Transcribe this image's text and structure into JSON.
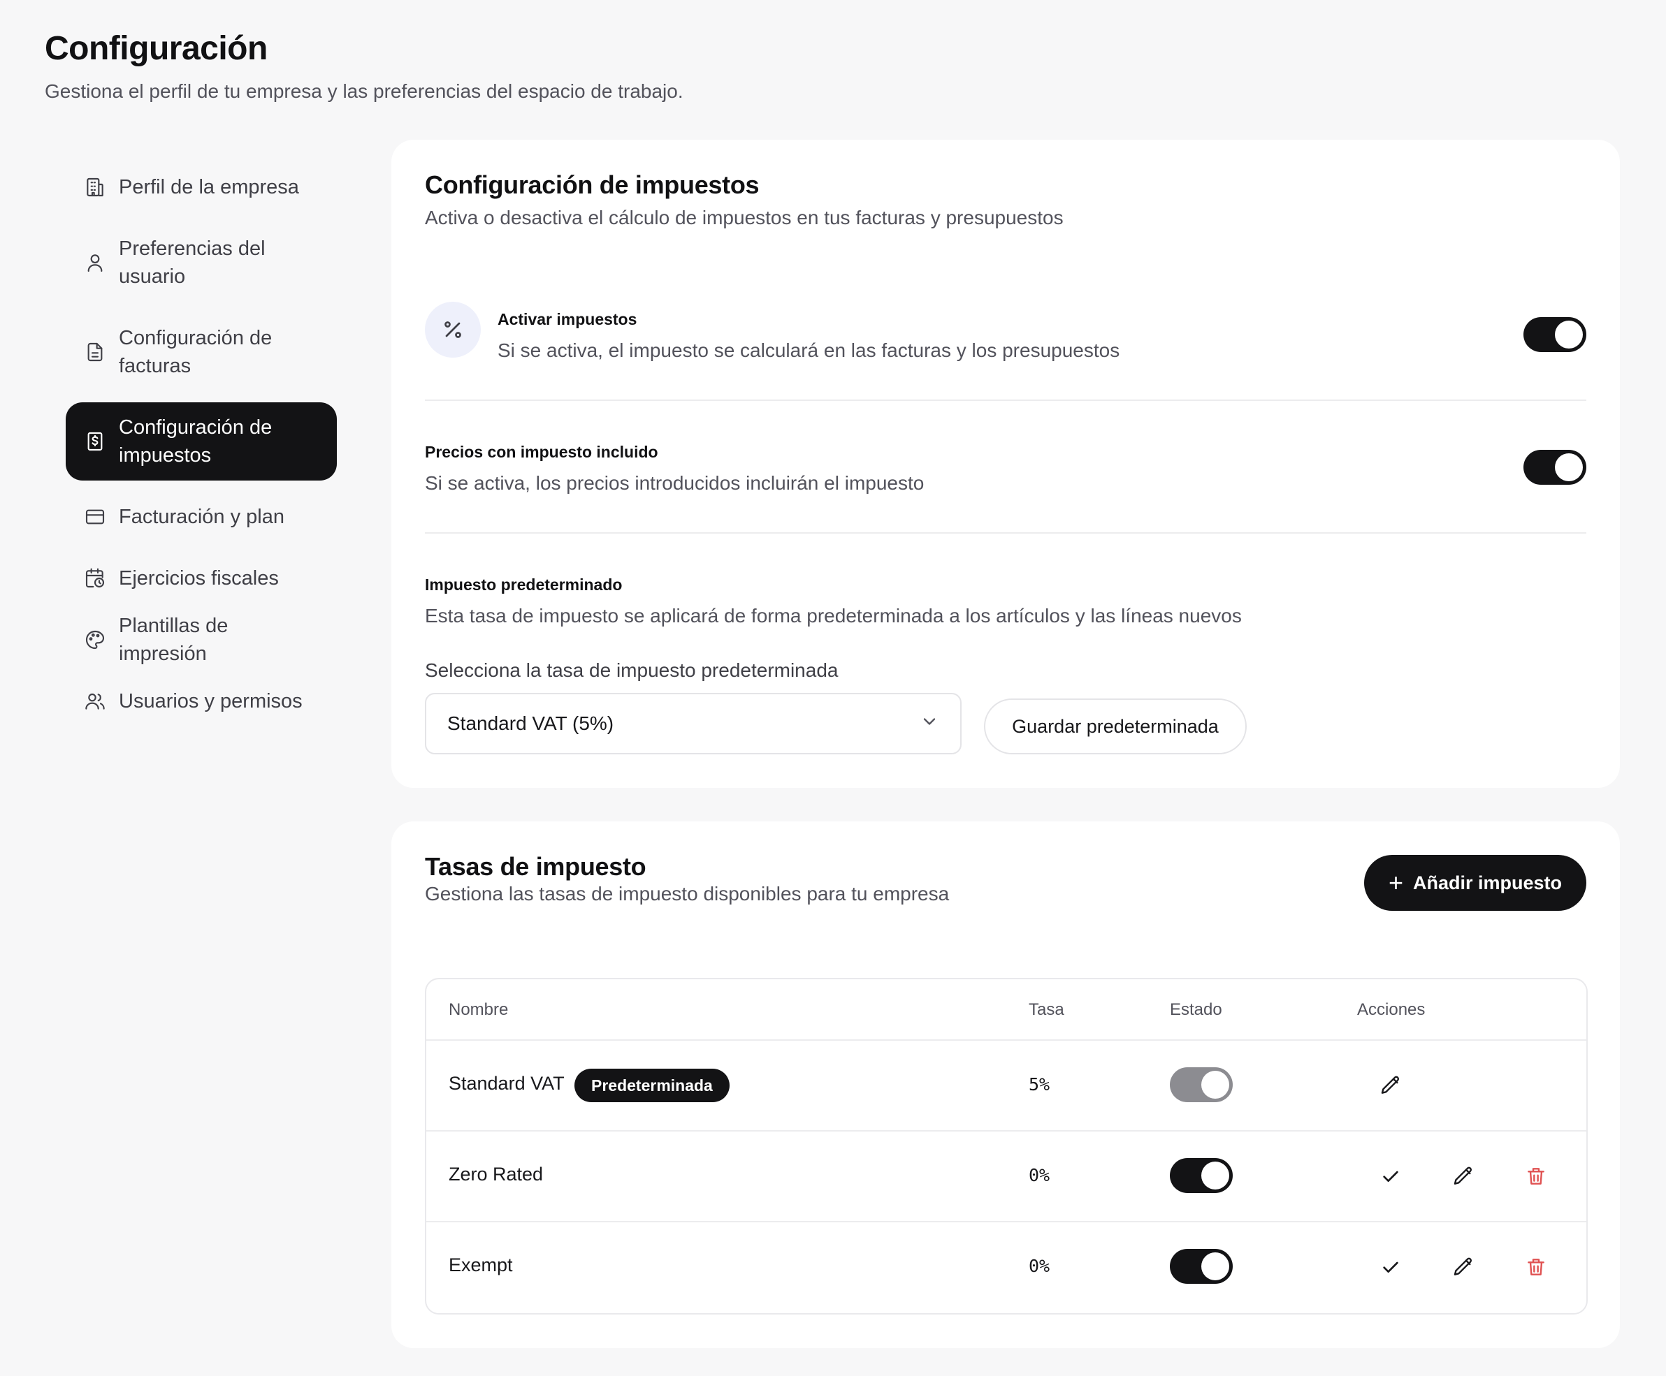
{
  "page": {
    "title": "Configuración",
    "subtitle": "Gestiona el perfil de tu empresa y las preferencias del espacio de trabajo."
  },
  "sidebar": {
    "items": [
      {
        "label": "Perfil de la empresa",
        "icon": "building-icon",
        "active": false
      },
      {
        "label": "Preferencias del usuario",
        "icon": "user-icon",
        "active": false
      },
      {
        "label": "Configuración de facturas",
        "icon": "document-icon",
        "active": false
      },
      {
        "label": "Configuración de impuestos",
        "icon": "receipt-icon",
        "active": true
      },
      {
        "label": "Facturación y plan",
        "icon": "credit-card-icon",
        "active": false
      },
      {
        "label": "Ejercicios fiscales",
        "icon": "calendar-clock-icon",
        "active": false
      },
      {
        "label": "Plantillas de impresión",
        "icon": "palette-icon",
        "active": false
      },
      {
        "label": "Usuarios y permisos",
        "icon": "users-icon",
        "active": false
      }
    ]
  },
  "tax_config": {
    "title": "Configuración de impuestos",
    "description": "Activa o desactiva el cálculo de impuestos en tus facturas y presupuestos",
    "enable_taxes": {
      "label": "Activar impuestos",
      "help": "Si se activa, el impuesto se calculará en las facturas y los presupuestos",
      "icon": "percent-icon",
      "enabled": true
    },
    "tax_inclusive": {
      "label": "Precios con impuesto incluido",
      "help": "Si se activa, los precios introducidos incluirán el impuesto",
      "enabled": true
    },
    "default_tax": {
      "label": "Impuesto predeterminado",
      "help": "Esta tasa de impuesto se aplicará de forma predeterminada a los artículos y las líneas nuevos",
      "select_label": "Selecciona la tasa de impuesto predeterminada",
      "selected_value": "Standard VAT (5%)",
      "save_label": "Guardar predeterminada"
    }
  },
  "tax_rates": {
    "title": "Tasas de impuesto",
    "description": "Gestiona las tasas de impuesto disponibles para tu empresa",
    "add_label": "Añadir impuesto",
    "columns": {
      "name": "Nombre",
      "rate": "Tasa",
      "status": "Estado",
      "actions": "Acciones"
    },
    "rows": [
      {
        "name": "Standard VAT",
        "badge": "Predeterminada",
        "rate": "5%",
        "active": true,
        "status_locked": true
      },
      {
        "name": "Zero Rated",
        "badge": "",
        "rate": "0%",
        "active": true,
        "status_locked": false
      },
      {
        "name": "Exempt",
        "badge": "",
        "rate": "0%",
        "active": true,
        "status_locked": false
      }
    ]
  },
  "colors": {
    "primary": "#131315",
    "danger": "#e05252",
    "muted_toggle": "#8c8c91",
    "icon_bg": "#eef0fb"
  }
}
